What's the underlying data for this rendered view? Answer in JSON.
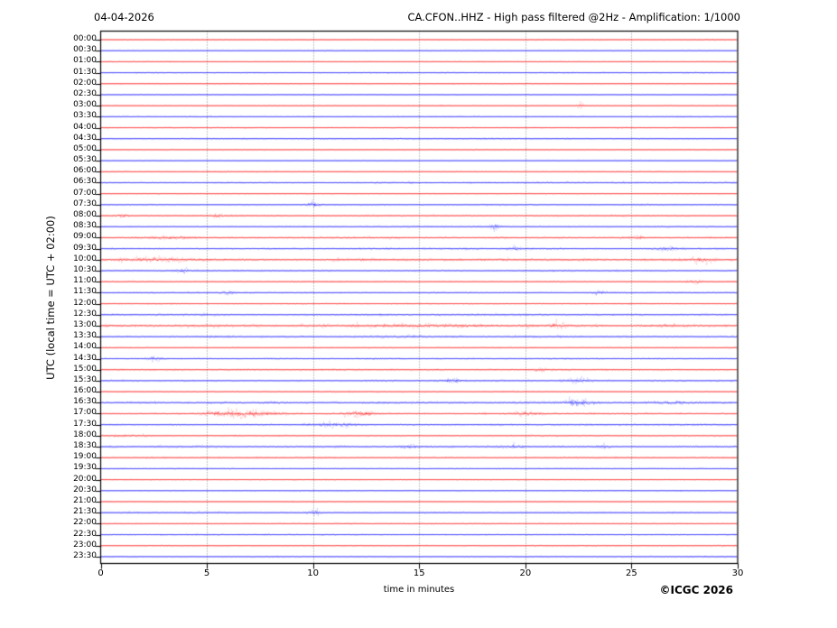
{
  "header": {
    "date": "04-04-2026",
    "title": "CA.CFON..HHZ - High pass filtered @2Hz - Amplification: 1/1000"
  },
  "axes": {
    "ylabel": "UTC (local time = UTC + 02:00)"
  },
  "footer": {
    "xlabel": "time in minutes",
    "copyright": "©ICGC 2026"
  },
  "chart_data": {
    "type": "line",
    "subtype": "helicorder-dayplot",
    "title": "CA.CFON..HHZ - High pass filtered @2Hz - Amplification: 1/1000",
    "date": "04-04-2026",
    "xlabel": "time in minutes",
    "ylabel": "UTC (local time = UTC + 02:00)",
    "xlim": [
      0,
      30
    ],
    "x_ticks": [
      0,
      5,
      10,
      15,
      20,
      25,
      30
    ],
    "minutes_per_row": 30,
    "grid": "vertical dotted lines at 5-minute intervals",
    "legend": "rows alternate color: hh:00 red, hh:30 blue",
    "colors": {
      "hour_row": "#ff0000",
      "half_hour_row": "#0000ff",
      "grid": "#7a7a7a",
      "frame": "#000000"
    },
    "rows": [
      {
        "label": "00:00",
        "color": "#ff0000",
        "noise": 0.35,
        "events": []
      },
      {
        "label": "00:30",
        "color": "#0000ff",
        "noise": 0.35,
        "events": []
      },
      {
        "label": "01:00",
        "color": "#ff0000",
        "noise": 0.35,
        "events": []
      },
      {
        "label": "01:30",
        "color": "#0000ff",
        "noise": 0.45,
        "events": []
      },
      {
        "label": "02:00",
        "color": "#ff0000",
        "noise": 0.35,
        "events": []
      },
      {
        "label": "02:30",
        "color": "#0000ff",
        "noise": 0.35,
        "events": []
      },
      {
        "label": "03:00",
        "color": "#ff0000",
        "noise": 0.35,
        "events": [
          {
            "t": 22.6,
            "w": 0.12,
            "a": 2.6
          }
        ]
      },
      {
        "label": "03:30",
        "color": "#0000ff",
        "noise": 0.4,
        "events": []
      },
      {
        "label": "04:00",
        "color": "#ff0000",
        "noise": 0.45,
        "events": []
      },
      {
        "label": "04:30",
        "color": "#0000ff",
        "noise": 0.45,
        "events": []
      },
      {
        "label": "05:00",
        "color": "#ff0000",
        "noise": 0.35,
        "events": []
      },
      {
        "label": "05:30",
        "color": "#0000ff",
        "noise": 0.35,
        "events": []
      },
      {
        "label": "06:00",
        "color": "#ff0000",
        "noise": 0.45,
        "events": []
      },
      {
        "label": "06:30",
        "color": "#0000ff",
        "noise": 0.6,
        "events": []
      },
      {
        "label": "07:00",
        "color": "#ff0000",
        "noise": 0.35,
        "events": []
      },
      {
        "label": "07:30",
        "color": "#0000ff",
        "noise": 0.45,
        "events": [
          {
            "t": 10.0,
            "w": 0.3,
            "a": 2.0
          }
        ]
      },
      {
        "label": "08:00",
        "color": "#ff0000",
        "noise": 0.55,
        "events": [
          {
            "t": 1.0,
            "w": 0.25,
            "a": 1.5
          },
          {
            "t": 5.5,
            "w": 0.25,
            "a": 1.5
          }
        ]
      },
      {
        "label": "08:30",
        "color": "#0000ff",
        "noise": 0.5,
        "events": [
          {
            "t": 18.6,
            "w": 0.3,
            "a": 2.0
          }
        ]
      },
      {
        "label": "09:00",
        "color": "#ff0000",
        "noise": 0.65,
        "events": [
          {
            "t": 3.4,
            "w": 1.1,
            "a": 1.1
          },
          {
            "t": 25.3,
            "w": 0.3,
            "a": 1.4
          }
        ]
      },
      {
        "label": "09:30",
        "color": "#0000ff",
        "noise": 0.6,
        "events": [
          {
            "t": 19.5,
            "w": 0.3,
            "a": 1.4
          },
          {
            "t": 26.7,
            "w": 0.5,
            "a": 1.4
          }
        ]
      },
      {
        "label": "10:00",
        "color": "#ff0000",
        "noise": 1.0,
        "events": [
          {
            "t": 2.3,
            "w": 1.6,
            "a": 1.2
          },
          {
            "t": 28.3,
            "w": 0.5,
            "a": 1.5
          }
        ]
      },
      {
        "label": "10:30",
        "color": "#0000ff",
        "noise": 0.7,
        "events": [
          {
            "t": 3.9,
            "w": 0.3,
            "a": 1.7
          }
        ]
      },
      {
        "label": "11:00",
        "color": "#ff0000",
        "noise": 0.5,
        "events": [
          {
            "t": 28.0,
            "w": 0.3,
            "a": 1.4
          }
        ]
      },
      {
        "label": "11:30",
        "color": "#0000ff",
        "noise": 0.5,
        "events": [
          {
            "t": 6.0,
            "w": 0.3,
            "a": 1.7
          },
          {
            "t": 23.4,
            "w": 0.3,
            "a": 1.2
          }
        ]
      },
      {
        "label": "12:00",
        "color": "#ff0000",
        "noise": 0.5,
        "events": []
      },
      {
        "label": "12:30",
        "color": "#0000ff",
        "noise": 0.7,
        "events": []
      },
      {
        "label": "13:00",
        "color": "#ff0000",
        "noise": 1.0,
        "events": [
          {
            "t": 15.5,
            "w": 3.5,
            "a": 0.8
          },
          {
            "t": 21.5,
            "w": 0.4,
            "a": 1.3
          },
          {
            "t": 26.5,
            "w": 0.6,
            "a": 0.9
          }
        ]
      },
      {
        "label": "13:30",
        "color": "#0000ff",
        "noise": 0.7,
        "events": [
          {
            "t": 14.0,
            "w": 1.8,
            "a": 0.6
          }
        ]
      },
      {
        "label": "14:00",
        "color": "#ff0000",
        "noise": 0.4,
        "events": []
      },
      {
        "label": "14:30",
        "color": "#0000ff",
        "noise": 0.55,
        "events": [
          {
            "t": 2.5,
            "w": 0.3,
            "a": 1.4
          }
        ]
      },
      {
        "label": "15:00",
        "color": "#ff0000",
        "noise": 0.6,
        "events": [
          {
            "t": 20.6,
            "w": 0.35,
            "a": 1.4
          }
        ]
      },
      {
        "label": "15:30",
        "color": "#0000ff",
        "noise": 0.55,
        "events": [
          {
            "t": 16.6,
            "w": 0.4,
            "a": 1.6
          },
          {
            "t": 22.5,
            "w": 0.6,
            "a": 1.5
          }
        ]
      },
      {
        "label": "16:00",
        "color": "#ff0000",
        "noise": 0.45,
        "events": []
      },
      {
        "label": "16:30",
        "color": "#0000ff",
        "noise": 0.85,
        "events": [
          {
            "t": 22.4,
            "w": 0.55,
            "a": 2.1
          },
          {
            "t": 27.0,
            "w": 0.9,
            "a": 0.8
          }
        ]
      },
      {
        "label": "17:00",
        "color": "#ff0000",
        "noise": 0.65,
        "events": [
          {
            "t": 6.6,
            "w": 1.6,
            "a": 2.4
          },
          {
            "t": 12.2,
            "w": 0.7,
            "a": 2.2
          },
          {
            "t": 20.0,
            "w": 0.9,
            "a": 1.1
          }
        ]
      },
      {
        "label": "17:30",
        "color": "#0000ff",
        "noise": 0.6,
        "events": [
          {
            "t": 11.0,
            "w": 1.1,
            "a": 1.3
          }
        ]
      },
      {
        "label": "18:00",
        "color": "#ff0000",
        "noise": 0.5,
        "events": [
          {
            "t": 1.5,
            "w": 1.2,
            "a": 0.5
          }
        ]
      },
      {
        "label": "18:30",
        "color": "#0000ff",
        "noise": 0.75,
        "events": [
          {
            "t": 14.5,
            "w": 0.35,
            "a": 1.3
          },
          {
            "t": 19.5,
            "w": 0.35,
            "a": 1.3
          },
          {
            "t": 23.7,
            "w": 0.35,
            "a": 1.3
          }
        ]
      },
      {
        "label": "19:00",
        "color": "#ff0000",
        "noise": 0.55,
        "events": []
      },
      {
        "label": "19:30",
        "color": "#0000ff",
        "noise": 0.4,
        "events": []
      },
      {
        "label": "20:00",
        "color": "#ff0000",
        "noise": 0.35,
        "events": []
      },
      {
        "label": "20:30",
        "color": "#0000ff",
        "noise": 0.35,
        "events": []
      },
      {
        "label": "21:00",
        "color": "#ff0000",
        "noise": 0.35,
        "events": []
      },
      {
        "label": "21:30",
        "color": "#0000ff",
        "noise": 0.55,
        "events": [
          {
            "t": 10.1,
            "w": 0.35,
            "a": 1.5
          }
        ]
      },
      {
        "label": "22:00",
        "color": "#ff0000",
        "noise": 0.45,
        "events": []
      },
      {
        "label": "22:30",
        "color": "#0000ff",
        "noise": 0.45,
        "events": []
      },
      {
        "label": "23:00",
        "color": "#ff0000",
        "noise": 0.45,
        "events": []
      },
      {
        "label": "23:30",
        "color": "#0000ff",
        "noise": 0.45,
        "events": []
      }
    ]
  }
}
